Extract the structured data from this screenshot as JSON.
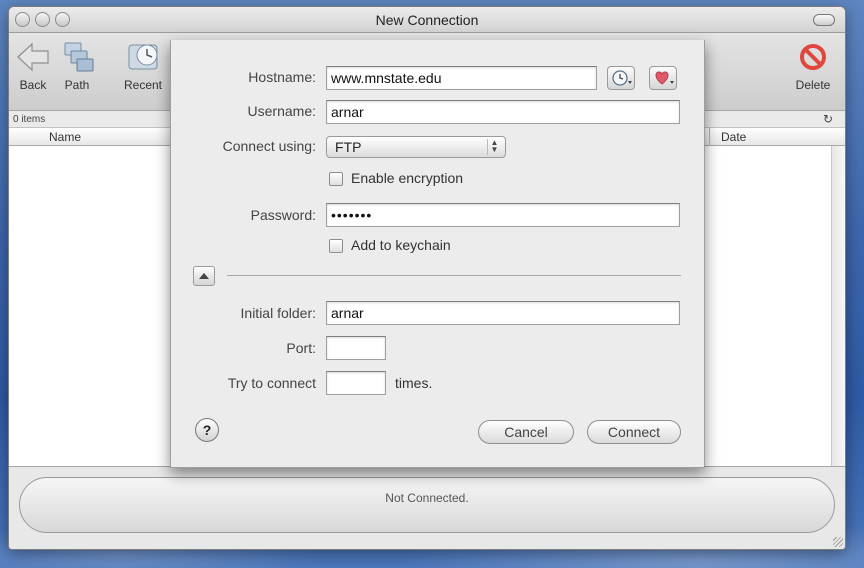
{
  "window": {
    "title": "New Connection"
  },
  "toolbar": {
    "back_label": "Back",
    "path_label": "Path",
    "recent_label": "Recent",
    "delete_label": "Delete"
  },
  "browser": {
    "item_count": "0 items",
    "columns": [
      "Name",
      "Date"
    ],
    "status": "Not Connected."
  },
  "sheet": {
    "hostname_label": "Hostname:",
    "hostname_value": "www.mnstate.edu",
    "username_label": "Username:",
    "username_value": "arnar",
    "connect_using_label": "Connect using:",
    "connect_using_value": "FTP",
    "enable_encryption_label": "Enable encryption",
    "password_label": "Password:",
    "password_value": "•••••••",
    "add_keychain_label": "Add to keychain",
    "initial_folder_label": "Initial folder:",
    "initial_folder_value": "arnar",
    "port_label": "Port:",
    "port_value": "",
    "try_label": "Try to connect",
    "try_value": "",
    "times_label": "times.",
    "cancel_label": "Cancel",
    "connect_label": "Connect",
    "help_glyph": "?"
  },
  "colors": {
    "delete_icon": "#e0463c",
    "favorite_icon": "#e05a6a"
  }
}
